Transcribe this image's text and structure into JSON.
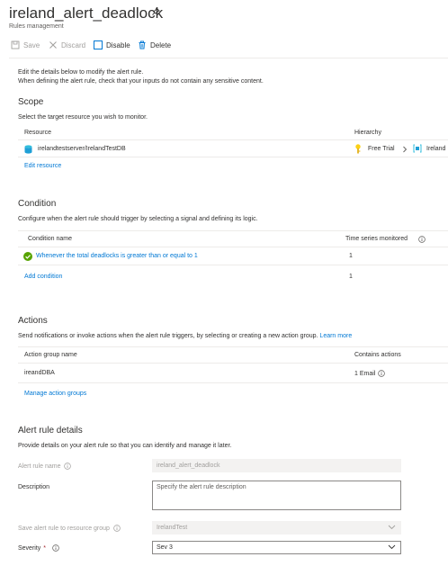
{
  "header": {
    "title": "ireland_alert_deadlock",
    "subtitle": "Rules management"
  },
  "toolbar": {
    "save": "Save",
    "discard": "Discard",
    "disable": "Disable",
    "delete": "Delete"
  },
  "intro": {
    "line1": "Edit the details below to modify the alert rule.",
    "line2": "When defining the alert rule, check that your inputs do not contain any sensitive content."
  },
  "scope": {
    "title": "Scope",
    "desc": "Select the target resource you wish to monitor.",
    "col_resource": "Resource",
    "col_hierarchy": "Hierarchy",
    "resource": "irelandtestserver/IrelandTestDB",
    "hier_sub": "Free Trial",
    "hier_rg": "Ireland",
    "edit_link": "Edit resource"
  },
  "condition": {
    "title": "Condition",
    "desc": "Configure when the alert rule should trigger by selecting a signal and defining its logic.",
    "col_name": "Condition name",
    "col_ts": "Time series monitored",
    "row_name": "Whenever the total deadlocks is greater than or equal to 1",
    "row_ts": "1",
    "add_link": "Add condition",
    "add_ts": "1"
  },
  "actions": {
    "title": "Actions",
    "desc": "Send notifications or invoke actions when the alert rule triggers, by selecting or creating a new action group.",
    "learn_more": "Learn more",
    "col_name": "Action group name",
    "col_contains": "Contains actions",
    "row_name": "ireandDBA",
    "row_contains": "1 Email",
    "manage_link": "Manage action groups"
  },
  "details": {
    "title": "Alert rule details",
    "desc": "Provide details on your alert rule so that you can identify and manage it later.",
    "name_label": "Alert rule name",
    "name_value": "ireland_alert_deadlock",
    "desc_label": "Description",
    "desc_placeholder": "Specify the alert rule description",
    "rg_label": "Save alert rule to resource group",
    "rg_value": "IrelandTest",
    "sev_label": "Severity",
    "sev_required": "*",
    "sev_value": "Sev 3"
  },
  "colors": {
    "link": "#0078d4",
    "success": "#57a300",
    "key": "#fcd116"
  }
}
